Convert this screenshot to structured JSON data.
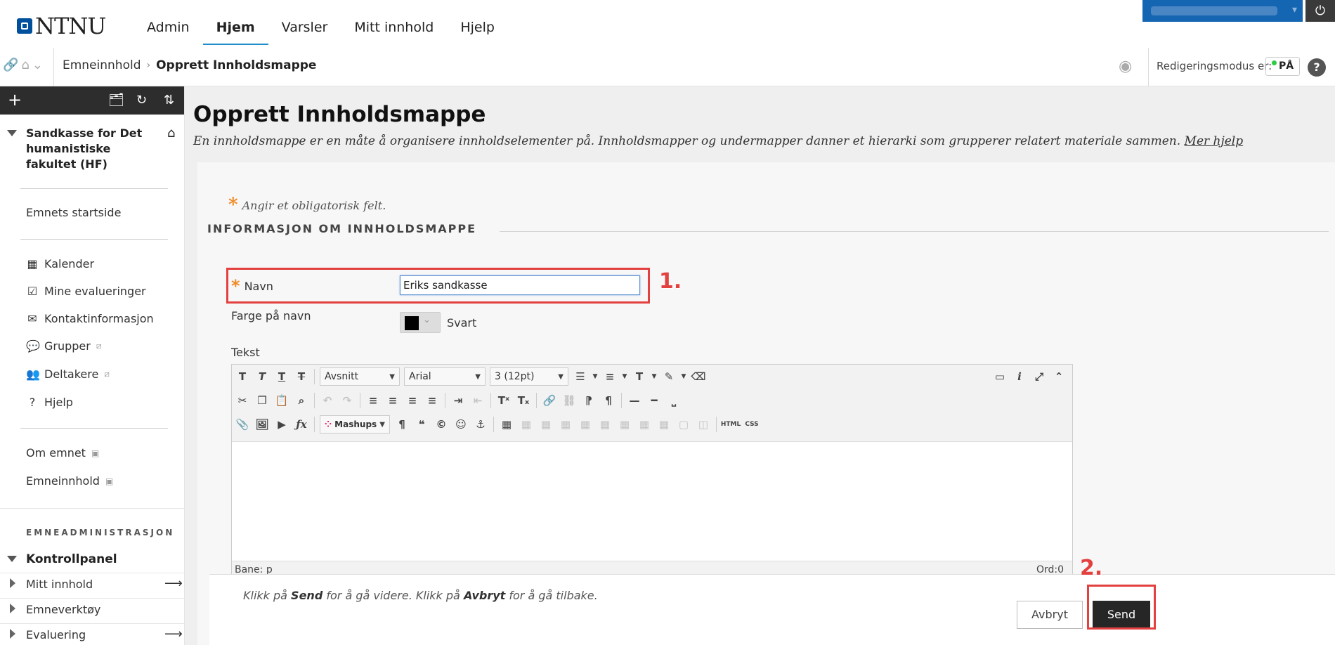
{
  "app": {
    "logo_text": "NTNU",
    "nav_tabs": [
      "Admin",
      "Hjem",
      "Varsler",
      "Mitt innhold",
      "Hjelp"
    ],
    "active_tab": "Hjem"
  },
  "breadcrumb": {
    "items": [
      "Emneinnhold",
      "Opprett Innholdsmappe"
    ],
    "separator": "›"
  },
  "edit_mode": {
    "label": "Redigeringsmodus er:",
    "state": "PÅ",
    "help": "?"
  },
  "sidebar": {
    "course_title": "Sandkasse for Det humanistiske fakultet (HF)",
    "links": [
      {
        "label": "Emnets startside",
        "icon": ""
      },
      {
        "label": "Kalender",
        "icon": "calendar-icon"
      },
      {
        "label": "Mine evalueringer",
        "icon": "checkbox-icon"
      },
      {
        "label": "Kontaktinformasjon",
        "icon": "envelope-icon"
      },
      {
        "label": "Grupper",
        "icon": "chat-icon"
      },
      {
        "label": "Deltakere",
        "icon": "people-icon"
      },
      {
        "label": "Hjelp",
        "icon": "question-icon"
      },
      {
        "label": "Om emnet",
        "icon": ""
      },
      {
        "label": "Emneinnhold",
        "icon": ""
      }
    ],
    "admin_section": "EMNEADMINISTRASJON",
    "control_panel": "Kontrollpanel",
    "control_items": [
      "Mitt innhold",
      "Emneverktøy",
      "Evaluering"
    ]
  },
  "page": {
    "title": "Opprett Innholdsmappe",
    "description": "En innholdsmappe er en måte å organisere innholdselementer på. Innholdsmapper og undermapper danner et hierarki som grupperer relatert materiale sammen.",
    "more_help": "Mer hjelp",
    "required_note": "Angir et obligatorisk felt.",
    "section_heading": "INFORMASJON OM INNHOLDSMAPPE"
  },
  "form": {
    "name_label": "Navn",
    "name_value": "Eriks sandkasse",
    "color_label": "Farge på navn",
    "color_value": "Svart",
    "color_hex": "#000000",
    "text_label": "Tekst"
  },
  "editor": {
    "format_select": "Avsnitt",
    "font_select": "Arial",
    "size_select": "3 (12pt)",
    "mashups_label": "Mashups",
    "html_label": "HTML",
    "css_label": "CSS",
    "status_path": "Bane: p",
    "word_count": "Ord:0"
  },
  "submit": {
    "note_part1": "Klikk på ",
    "note_send": "Send",
    "note_part2": " for å gå videre. Klikk på ",
    "note_cancel": "Avbryt",
    "note_part3": " for å gå tilbake.",
    "cancel_label": "Avbryt",
    "send_label": "Send"
  },
  "annotations": [
    "1.",
    "2."
  ],
  "colors": {
    "accent": "#1f8fc9",
    "user_bar": "#1466b3",
    "required": "#f08a24",
    "annotation": "#e34040",
    "send_button": "#262626"
  }
}
